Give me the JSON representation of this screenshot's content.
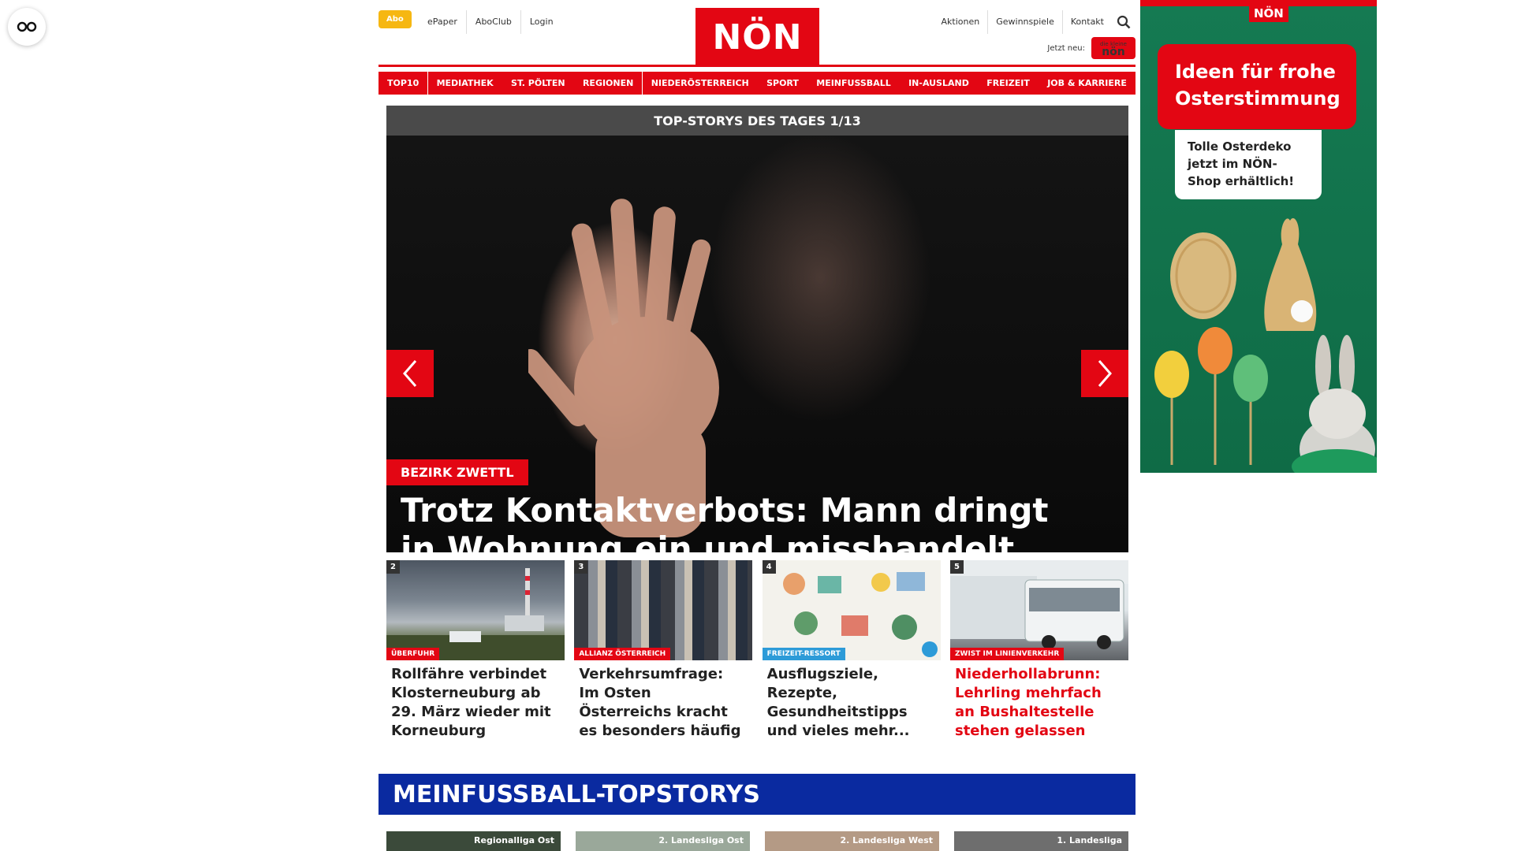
{
  "header": {
    "abo": "Abo",
    "links": [
      "ePaper",
      "AboClub",
      "Login"
    ],
    "logo": "NÖN",
    "right_links": [
      "Aktionen",
      "Gewinnspiele",
      "Kontakt"
    ],
    "jetzt_neu": "Jetzt neu:",
    "kleine_small": "die kleine",
    "kleine_big": "nön"
  },
  "nav": [
    "TOP10",
    "MEDIATHEK",
    "ST. PÖLTEN",
    "REGIONEN",
    "NIEDERÖSTERREICH",
    "SPORT",
    "MEINFUSSBALL",
    "IN-AUSLAND",
    "FREIZEIT",
    "JOB & KARRIERE"
  ],
  "hero": {
    "header": "TOP-STORYS DES TAGES 1/13",
    "category": "BEZIRK ZWETTL",
    "title": "Trotz Kontaktverbots: Mann dringt in Wohnung ein und misshandelt Frau"
  },
  "stories": [
    {
      "num": "2",
      "tag": "ÜBERFUHR",
      "title": "Rollfähre verbindet Klosterneuburg ab 29. März wieder mit Korneuburg"
    },
    {
      "num": "3",
      "tag": "ALLIANZ ÖSTERREICH",
      "title": "Verkehrsumfrage: Im Osten Österreichs kracht es besonders häufig"
    },
    {
      "num": "4",
      "tag": "FREIZEIT-RESSORT",
      "title": "Ausflugsziele, Rezepte, Gesundheitstipps und vieles mehr..."
    },
    {
      "num": "5",
      "tag": "ZWIST IM LINIENVERKEHR",
      "title": "Niederhollabrunn: Lehrling mehrfach an Bushaltestelle stehen gelassen"
    }
  ],
  "meinfussball": {
    "title": "MEINFUSSBALL-TOPSTORYS",
    "items": [
      "Regionalliga Ost",
      "2. Landesliga Ost",
      "2. Landesliga West",
      "1. Landesliga"
    ]
  },
  "ad": {
    "logo": "NÖN",
    "headline": "Ideen für frohe Osterstimmung",
    "sub": "Tolle Osterdeko jetzt im NÖN-Shop erhältlich!"
  },
  "colors": {
    "brand_red": "#e30613",
    "abo_yellow": "#f6b712",
    "fussball_blue": "#0a2aa0",
    "ad_green": "#157a52"
  }
}
